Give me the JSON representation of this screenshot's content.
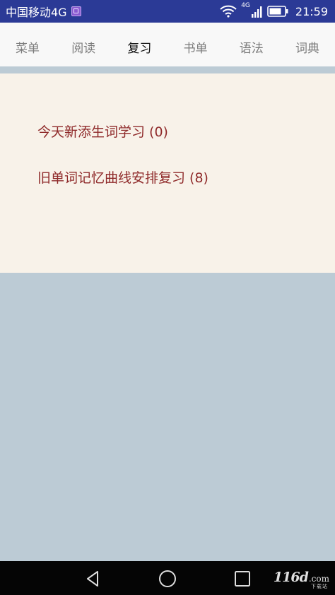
{
  "status_bar": {
    "carrier": "中国移动4G",
    "network_type": "4G",
    "time": "21:59",
    "icons": [
      "notification-icon",
      "wifi-icon",
      "signal-icon",
      "battery-icon"
    ]
  },
  "tabs": [
    {
      "label": "菜单",
      "active": false
    },
    {
      "label": "阅读",
      "active": false
    },
    {
      "label": "复习",
      "active": true
    },
    {
      "label": "书单",
      "active": false
    },
    {
      "label": "语法",
      "active": false
    },
    {
      "label": "词典",
      "active": false
    }
  ],
  "review": {
    "new_words_label": "今天新添生词学习 (0)",
    "old_words_label": "旧单词记忆曲线安排复习 (8)"
  },
  "nav_bar": {
    "icons": [
      "back-icon",
      "home-icon",
      "recent-apps-icon"
    ]
  },
  "watermark": {
    "text": "116d",
    "suffix": ".com",
    "sub": "下载站"
  },
  "colors": {
    "status_bar": "#2b3a96",
    "tab_bar": "#f8f8f8",
    "panel": "#f8f2e9",
    "background": "#bccbd5",
    "link_text": "#8f2a2a",
    "nav_bar": "#050505"
  }
}
